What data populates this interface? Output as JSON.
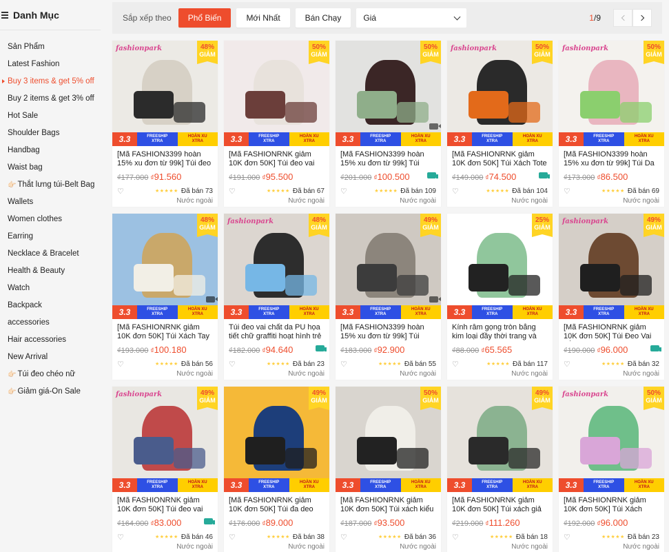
{
  "sidebar": {
    "title": "Danh Mục",
    "items": [
      {
        "label": "Sản Phẩm",
        "active": false,
        "hand": false
      },
      {
        "label": "Latest Fashion",
        "active": false,
        "hand": false
      },
      {
        "label": "Buy 3 items & get 5% off",
        "active": true,
        "hand": false
      },
      {
        "label": "Buy 2 items & get 3% off",
        "active": false,
        "hand": false
      },
      {
        "label": "Hot Sale",
        "active": false,
        "hand": false
      },
      {
        "label": "Shoulder Bags",
        "active": false,
        "hand": false
      },
      {
        "label": "Handbag",
        "active": false,
        "hand": false
      },
      {
        "label": "Waist bag",
        "active": false,
        "hand": false
      },
      {
        "label": "Thắt lưng túi-Belt Bag",
        "active": false,
        "hand": true
      },
      {
        "label": "Wallets",
        "active": false,
        "hand": false
      },
      {
        "label": "Women clothes",
        "active": false,
        "hand": false
      },
      {
        "label": "Earring",
        "active": false,
        "hand": false
      },
      {
        "label": "Necklace & Bracelet",
        "active": false,
        "hand": false
      },
      {
        "label": "Health & Beauty",
        "active": false,
        "hand": false
      },
      {
        "label": "Watch",
        "active": false,
        "hand": false
      },
      {
        "label": "Backpack",
        "active": false,
        "hand": false
      },
      {
        "label": "accessories",
        "active": false,
        "hand": false
      },
      {
        "label": "Hair accessories",
        "active": false,
        "hand": false
      },
      {
        "label": "New Arrival",
        "active": false,
        "hand": false
      },
      {
        "label": "Túi đeo chéo nữ",
        "active": false,
        "hand": true
      },
      {
        "label": "Giảm giá-On Sale",
        "active": false,
        "hand": true
      }
    ]
  },
  "sortbar": {
    "label": "Sắp xếp theo",
    "buttons": [
      "Phổ Biến",
      "Mới Nhất",
      "Bán Chạy"
    ],
    "price_label": "Giá",
    "page_current": "1",
    "page_total": "/9"
  },
  "labels": {
    "discount": "GIẢM",
    "origin": "Nước ngoài",
    "sold_prefix": "Đã bán",
    "promo_33": "3.3",
    "promo_fs1": "FREESHIP",
    "promo_fs2": "XTRA",
    "promo_hx1": "HOÀN XU",
    "promo_hx2": "XTRA",
    "stars": "★★★★★",
    "currency": "₫"
  },
  "products": [
    {
      "name": "[Mã FASHION3399 hoàn 15% xu đơn từ 99k] Túi đeo vai ch...",
      "old": "₫177.000",
      "price": "91.560",
      "discount": "48%",
      "sold": "73",
      "brand": "fashionpark",
      "video": false,
      "ship": false,
      "colors": [
        "#eceae5",
        "#2b2b2b",
        "#d7d1c6"
      ]
    },
    {
      "name": "[Mã FASHIONRNK giảm 10K đơn 50K] Túi đeo vai nhung lô...",
      "old": "₫191.000",
      "price": "95.500",
      "discount": "50%",
      "sold": "67",
      "brand": "",
      "video": false,
      "ship": false,
      "colors": [
        "#f1eaea",
        "#6b3e3a",
        "#e8e2dc"
      ]
    },
    {
      "name": "[Mã FASHION3399 hoàn 15% xu đơn từ 99k] Túi xách da P...",
      "old": "₫201.000",
      "price": "100.500",
      "discount": "50%",
      "sold": "109",
      "brand": "",
      "video": true,
      "ship": true,
      "colors": [
        "#e2e2e0",
        "#8fae8a",
        "#3b2626"
      ]
    },
    {
      "name": "[Mã FASHIONRNK giảm 10K đơn 50K] Túi Xách Tote Vải...",
      "old": "₫149.000",
      "price": "74.500",
      "discount": "50%",
      "sold": "104",
      "brand": "fashionpark",
      "video": false,
      "ship": true,
      "colors": [
        "#ece9e4",
        "#e36a1a",
        "#2a2a2a"
      ]
    },
    {
      "name": "[Mã FASHION3399 hoàn 15% xu đơn từ 99k] Túi Da Đeo Ch...",
      "old": "₫173.000",
      "price": "86.500",
      "discount": "50%",
      "sold": "69",
      "brand": "fashionpark",
      "video": false,
      "ship": false,
      "colors": [
        "#f4f2ee",
        "#8bcf6e",
        "#e9b6c0"
      ]
    },
    {
      "name": "[Mã FASHIONRNK giảm 10K đơn 50K] Túi Xách Tay Da Pu...",
      "old": "₫193.000",
      "price": "100.180",
      "discount": "48%",
      "sold": "56",
      "brand": "",
      "video": true,
      "ship": false,
      "colors": [
        "#9cc1e2",
        "#f2efe6",
        "#c9a86a"
      ]
    },
    {
      "name": "Túi đeo vai chất da PU họa tiết chữ graffiti hoạt hình trẻ trung...",
      "old": "₫182.000",
      "price": "94.640",
      "discount": "48%",
      "sold": "23",
      "brand": "fashionpark",
      "video": false,
      "ship": true,
      "colors": [
        "#dcd6d0",
        "#76b7e6",
        "#2d2d2d"
      ]
    },
    {
      "name": "[Mã FASHION3399 hoàn 15% xu đơn từ 99k] Túi canvas họ...",
      "old": "₫183.000",
      "price": "92.900",
      "discount": "49%",
      "sold": "55",
      "brand": "",
      "video": true,
      "ship": false,
      "colors": [
        "#cfc9c2",
        "#3c3c3c",
        "#8c857c"
      ]
    },
    {
      "name": "Kính râm gọng tròn bằng kim loại đầy thời trang và quý phái",
      "old": "₫88.000",
      "price": "65.565",
      "discount": "25%",
      "sold": "117",
      "brand": "",
      "video": false,
      "ship": false,
      "colors": [
        "#ffffff",
        "#222222",
        "#90c69c"
      ]
    },
    {
      "name": "[Mã FASHIONRNK giảm 10K đơn 50K] Túi Đeo Vai Bằng Da...",
      "old": "₫190.000",
      "price": "96.000",
      "discount": "49%",
      "sold": "32",
      "brand": "fashionpark",
      "video": false,
      "ship": true,
      "colors": [
        "#d5cfc8",
        "#1f1f1f",
        "#6d4a32"
      ]
    },
    {
      "name": "[Mã FASHIONRNK giảm 10K đơn 50K] Túi đeo vai nylon họ...",
      "old": "₫164.000",
      "price": "83.000",
      "discount": "49%",
      "sold": "46",
      "brand": "fashionpark",
      "video": false,
      "ship": true,
      "colors": [
        "#e9e7e2",
        "#4a5c8c",
        "#c04a4a"
      ]
    },
    {
      "name": "[Mã FASHIONRNK giảm 10K đơn 50K] Túi đa deo chéo kiể...",
      "old": "₫176.000",
      "price": "89.000",
      "discount": "49%",
      "sold": "38",
      "brand": "",
      "video": false,
      "ship": false,
      "colors": [
        "#f5b938",
        "#1f1f1f",
        "#1d3e7a"
      ]
    },
    {
      "name": "[Mã FASHIONRNK giảm 10K đơn 50K] Túi xách kiểu dáng...",
      "old": "₫187.000",
      "price": "93.500",
      "discount": "50%",
      "sold": "36",
      "brand": "",
      "video": false,
      "ship": false,
      "colors": [
        "#d9d5cf",
        "#222222",
        "#f0eee8"
      ]
    },
    {
      "name": "[Mã FASHIONRNK giảm 10K đơn 50K] Túi xách giả da cá s...",
      "old": "₫219.000",
      "price": "111.260",
      "discount": "49%",
      "sold": "18",
      "brand": "",
      "video": false,
      "ship": false,
      "colors": [
        "#e6e2dc",
        "#2a2a2a",
        "#8bb391"
      ]
    },
    {
      "name": "[Mã FASHIONRNK giảm 10K đơn 50K] Túi Xách Kiểu Da Cá...",
      "old": "₫192.000",
      "price": "96.000",
      "discount": "50%",
      "sold": "23",
      "brand": "fashionpark",
      "video": false,
      "ship": false,
      "colors": [
        "#f2f0ec",
        "#d9a6d8",
        "#6fbf8a"
      ]
    }
  ]
}
